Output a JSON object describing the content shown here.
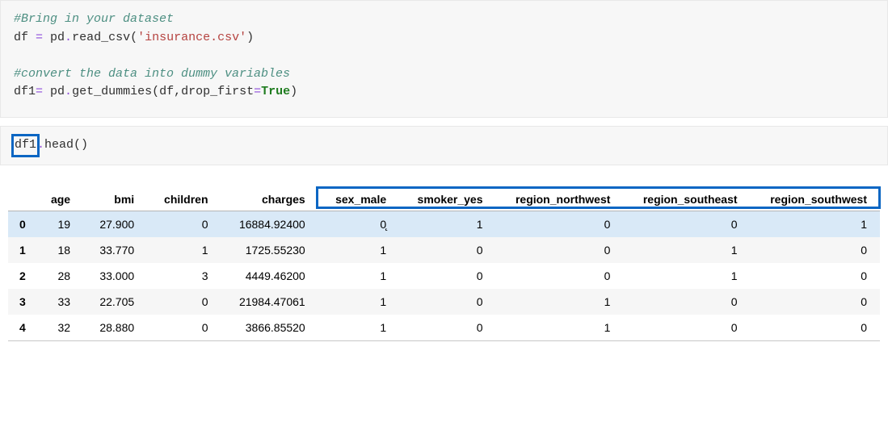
{
  "code": {
    "c1_comment1": "#Bring in your dataset",
    "c1_line2_a": "df ",
    "c1_line2_b": "=",
    "c1_line2_c": " pd",
    "c1_line2_d": ".",
    "c1_line2_e": "read_csv(",
    "c1_line2_f": "'insurance.csv'",
    "c1_line2_g": ")",
    "c1_comment2": "#convert the data into dummy variables",
    "c1_line4_a": "df1",
    "c1_line4_b": "=",
    "c1_line4_c": " pd",
    "c1_line4_d": ".",
    "c1_line4_e": "get_dummies(df,drop_first",
    "c1_line4_f": "=",
    "c1_line4_g": "True",
    "c1_line4_h": ")",
    "c2_line1_a": "df1",
    "c2_line1_b": ".",
    "c2_line1_c": "head()"
  },
  "chart_data": {
    "type": "table",
    "columns": [
      "age",
      "bmi",
      "children",
      "charges",
      "sex_male",
      "smoker_yes",
      "region_northwest",
      "region_southeast",
      "region_southwest"
    ],
    "index": [
      "0",
      "1",
      "2",
      "3",
      "4"
    ],
    "rows": [
      [
        "19",
        "27.900",
        "0",
        "16884.92400",
        "0",
        "1",
        "0",
        "0",
        "1"
      ],
      [
        "18",
        "33.770",
        "1",
        "1725.55230",
        "1",
        "0",
        "0",
        "1",
        "0"
      ],
      [
        "28",
        "33.000",
        "3",
        "4449.46200",
        "1",
        "0",
        "0",
        "1",
        "0"
      ],
      [
        "33",
        "22.705",
        "0",
        "21984.47061",
        "1",
        "0",
        "1",
        "0",
        "0"
      ],
      [
        "32",
        "28.880",
        "0",
        "3866.85520",
        "1",
        "0",
        "1",
        "0",
        "0"
      ]
    ],
    "row_hover": 0,
    "highlight_col_start": 4,
    "highlight_col_end": 8,
    "first_col_caret": "0̨"
  }
}
